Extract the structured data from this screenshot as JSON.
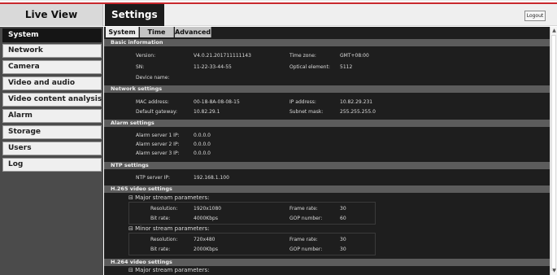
{
  "header": {
    "live_view": "Live View",
    "settings": "Settings",
    "logout": "Logout"
  },
  "sidebar": {
    "items": [
      {
        "label": "System"
      },
      {
        "label": "Network"
      },
      {
        "label": "Camera"
      },
      {
        "label": "Video and audio"
      },
      {
        "label": "Video content analysis"
      },
      {
        "label": "Alarm"
      },
      {
        "label": "Storage"
      },
      {
        "label": "Users"
      },
      {
        "label": "Log"
      }
    ]
  },
  "tabs": [
    {
      "label": "System"
    },
    {
      "label": "Time"
    },
    {
      "label": "Advanced"
    }
  ],
  "basic": {
    "title": "Basic information",
    "version_label": "Version:",
    "version": "V4.0.21.201711111143",
    "timezone_label": "Time zone:",
    "timezone": "GMT+08:00",
    "sn_label": "SN:",
    "sn": "11-22-33-44-55",
    "optical_label": "Optical element:",
    "optical": "5112",
    "device_name_label": "Device name:",
    "device_name": ""
  },
  "network": {
    "title": "Network settings",
    "mac_label": "MAC address:",
    "mac": "00-18-8A-08-08-15",
    "ip_label": "IP address:",
    "ip": "10.82.29.231",
    "gateway_label": "Default gateway:",
    "gateway": "10.82.29.1",
    "mask_label": "Subnet mask:",
    "mask": "255.255.255.0"
  },
  "alarm": {
    "title": "Alarm settings",
    "server1_label": "Alarm server 1 IP:",
    "server1": "0.0.0.0",
    "server2_label": "Alarm server 2 IP:",
    "server2": "0.0.0.0",
    "server3_label": "Alarm server 3 IP:",
    "server3": "0.0.0.0"
  },
  "ntp": {
    "title": "NTP settings",
    "server_label": "NTP server IP:",
    "server": "192.168.1.100"
  },
  "h265": {
    "title": "H.265 video settings",
    "major_title": "⊟ Major stream parameters:",
    "major_res_label": "Resolution:",
    "major_res": "1920x1080",
    "major_fps_label": "Frame rate:",
    "major_fps": "30",
    "major_bitrate_label": "Bit rate:",
    "major_bitrate": "4000Kbps",
    "major_gop_label": "GOP number:",
    "major_gop": "60",
    "minor_title": "⊟ Minor stream parameters:",
    "minor_res_label": "Resolution:",
    "minor_res": "720x480",
    "minor_fps_label": "Frame rate:",
    "minor_fps": "30",
    "minor_bitrate_label": "Bit rate:",
    "minor_bitrate": "2000Kbps",
    "minor_gop_label": "GOP number:",
    "minor_gop": "30"
  },
  "h264": {
    "title": "H.264 video settings",
    "major_title": "⊟ Major stream parameters:"
  },
  "colors": {
    "accent_red": "#c8282d",
    "active_nav": "#151515",
    "section_header": "#5c5c5c",
    "panel_bg": "#1e1e1e"
  },
  "icons": {
    "collapse": "collapse-icon",
    "scroll_up": "scroll-up-icon",
    "scroll_down": "scroll-down-icon"
  }
}
